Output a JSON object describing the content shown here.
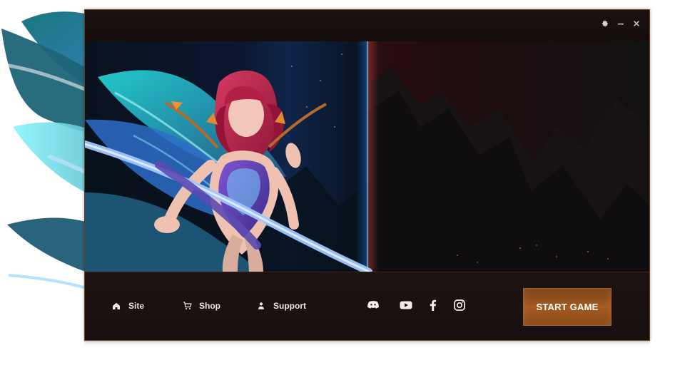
{
  "window": {
    "controls": {
      "settings": "settings-icon",
      "minimize": "minimize-icon",
      "close": "close-icon"
    }
  },
  "footer": {
    "nav_links": [
      {
        "label": "Site",
        "icon": "home-icon"
      },
      {
        "label": "Shop",
        "icon": "cart-icon"
      },
      {
        "label": "Support",
        "icon": "user-icon"
      }
    ],
    "social_icons": [
      {
        "icon": "discord-icon"
      },
      {
        "icon": "youtube-icon"
      },
      {
        "icon": "facebook-icon"
      },
      {
        "icon": "instagram-icon"
      }
    ],
    "start_label": "START GAME"
  },
  "colors": {
    "window_bg": "#0e0a0a",
    "accent_orange": "#a65b22",
    "accent_border": "#6b3f19",
    "text_light": "#ece7e3",
    "blue_glow": "#1f8dff",
    "red_glow": "#ff4d4d"
  },
  "banner": {
    "hero_icon": "fantasy-warrior-illustration"
  }
}
